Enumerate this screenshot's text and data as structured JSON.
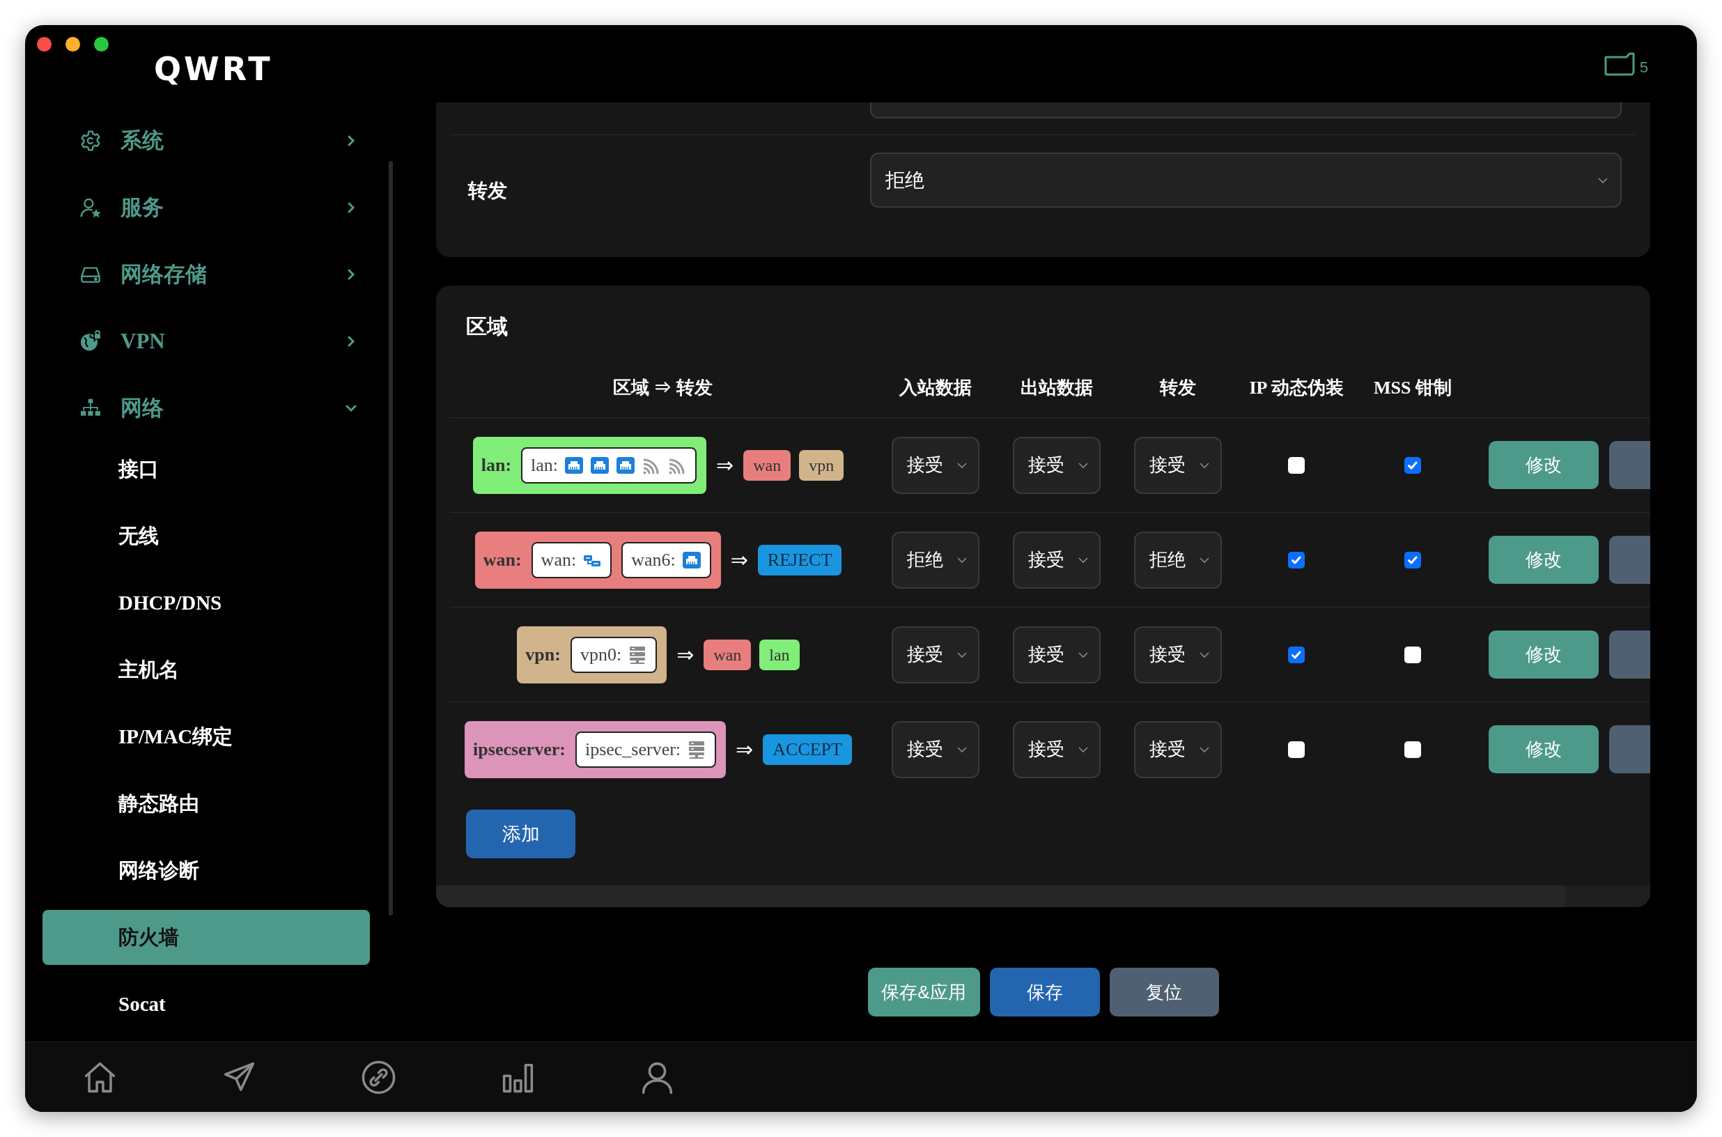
{
  "window": {
    "title": "QWRT"
  },
  "header": {
    "badge": "5"
  },
  "sidebar": {
    "items": [
      {
        "label": "系统",
        "expanded": false
      },
      {
        "label": "服务",
        "expanded": false
      },
      {
        "label": "网络存储",
        "expanded": false
      },
      {
        "label": "VPN",
        "expanded": false
      },
      {
        "label": "网络",
        "expanded": true,
        "children": [
          {
            "label": "接口",
            "selected": false
          },
          {
            "label": "无线",
            "selected": false
          },
          {
            "label": "DHCP/DNS",
            "selected": false
          },
          {
            "label": "主机名",
            "selected": false
          },
          {
            "label": "IP/MAC绑定",
            "selected": false
          },
          {
            "label": "静态路由",
            "selected": false
          },
          {
            "label": "网络诊断",
            "selected": false
          },
          {
            "label": "防火墙",
            "selected": true
          },
          {
            "label": "Socat",
            "selected": false
          }
        ]
      }
    ]
  },
  "general": {
    "forward": {
      "label": "转发",
      "value": "拒绝"
    }
  },
  "zones": {
    "title": "区域",
    "columns": [
      "区域 ⇒ 转发",
      "入站数据",
      "出站数据",
      "转发",
      "IP 动态伪装",
      "MSS 钳制"
    ],
    "rows": [
      {
        "zone": "lan:",
        "color": "#80ee78",
        "devices": [
          {
            "label": "lan:",
            "icons": [
              {
                "kind": "ethernet"
              },
              {
                "kind": "ethernet"
              },
              {
                "kind": "ethernet"
              },
              {
                "kind": "wireless"
              },
              {
                "kind": "wireless"
              }
            ]
          }
        ],
        "arrow": "⇒",
        "targets": [
          {
            "label": "wan",
            "color": "#e97e7e"
          },
          {
            "label": "vpn",
            "color": "#d2b48c"
          }
        ],
        "input": "接受",
        "output": "接受",
        "forward": "接受",
        "masq": false,
        "mss": true,
        "edit": "修改"
      },
      {
        "zone": "wan:",
        "color": "#e97e7e",
        "devices": [
          {
            "label": "wan:",
            "icons": [
              {
                "kind": "switch"
              }
            ]
          },
          {
            "label": "wan6:",
            "icons": [
              {
                "kind": "ethernet"
              }
            ]
          }
        ],
        "arrow": "⇒",
        "targets": [
          {
            "label": "REJECT",
            "color": "#1a96e0"
          }
        ],
        "input": "拒绝",
        "output": "接受",
        "forward": "拒绝",
        "masq": true,
        "mss": true,
        "edit": "修改"
      },
      {
        "zone": "vpn:",
        "color": "#d2b48c",
        "devices": [
          {
            "label": "vpn0:",
            "icons": [
              {
                "kind": "server"
              }
            ]
          }
        ],
        "arrow": "⇒",
        "targets": [
          {
            "label": "wan",
            "color": "#e97e7e"
          },
          {
            "label": "lan",
            "color": "#80ee78"
          }
        ],
        "input": "接受",
        "output": "接受",
        "forward": "接受",
        "masq": true,
        "mss": false,
        "edit": "修改"
      },
      {
        "zone": "ipsecserver:",
        "color": "#dc94b8",
        "devices": [
          {
            "label": "ipsec_server:",
            "icons": [
              {
                "kind": "server"
              }
            ]
          }
        ],
        "arrow": "⇒",
        "targets": [
          {
            "label": "ACCEPT",
            "color": "#1a96e0"
          }
        ],
        "input": "接受",
        "output": "接受",
        "forward": "接受",
        "masq": false,
        "mss": false,
        "edit": "修改"
      }
    ],
    "add": "添加"
  },
  "footer": {
    "buttons": [
      {
        "label": "保存&应用",
        "kind": "apply"
      },
      {
        "label": "保存",
        "kind": "save"
      },
      {
        "label": "复位",
        "kind": "reset"
      }
    ]
  }
}
